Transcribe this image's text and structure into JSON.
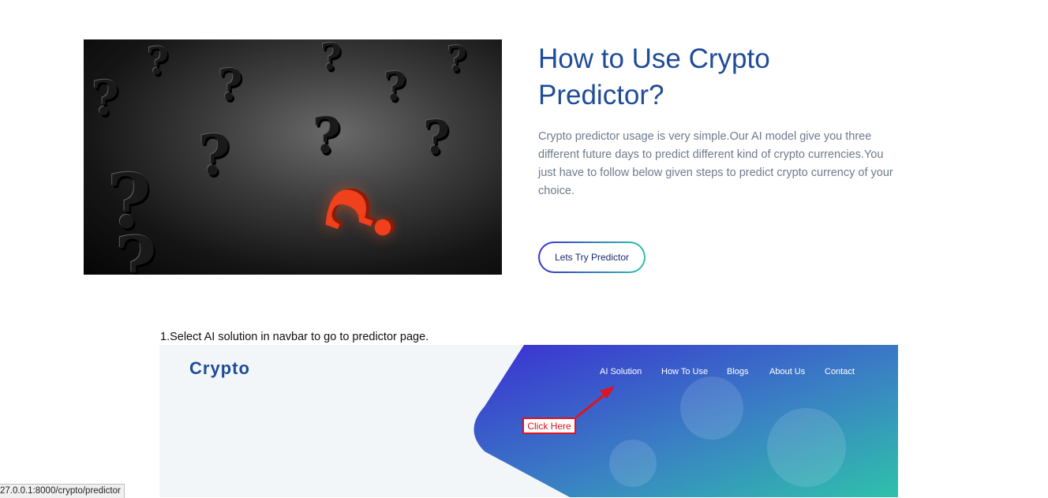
{
  "intro": {
    "title": "How to Use Crypto Predictor?",
    "description": "Crypto predictor usage is very simple.Our AI model give you three different future days to predict different kind of crypto currencies.You just have to follow below given steps to predict crypto currency of your choice.",
    "button_label": "Lets Try Predictor"
  },
  "steps": [
    {
      "text": "1.Select AI solution in navbar to go to predictor page.",
      "screenshot": {
        "logo": "Crypto",
        "nav": [
          "AI Solution",
          "How To Use",
          "Blogs",
          "About Us",
          "Contact"
        ],
        "callout": "Click Here"
      }
    }
  ],
  "status_bar": {
    "url": "27.0.0.1:8000/crypto/predictor"
  },
  "colors": {
    "title": "#1e4c98",
    "body_text": "#6f7a8d",
    "gradient_start": "#3a2fd0",
    "gradient_end": "#2fc1ab",
    "callout_red": "#e0131e"
  }
}
